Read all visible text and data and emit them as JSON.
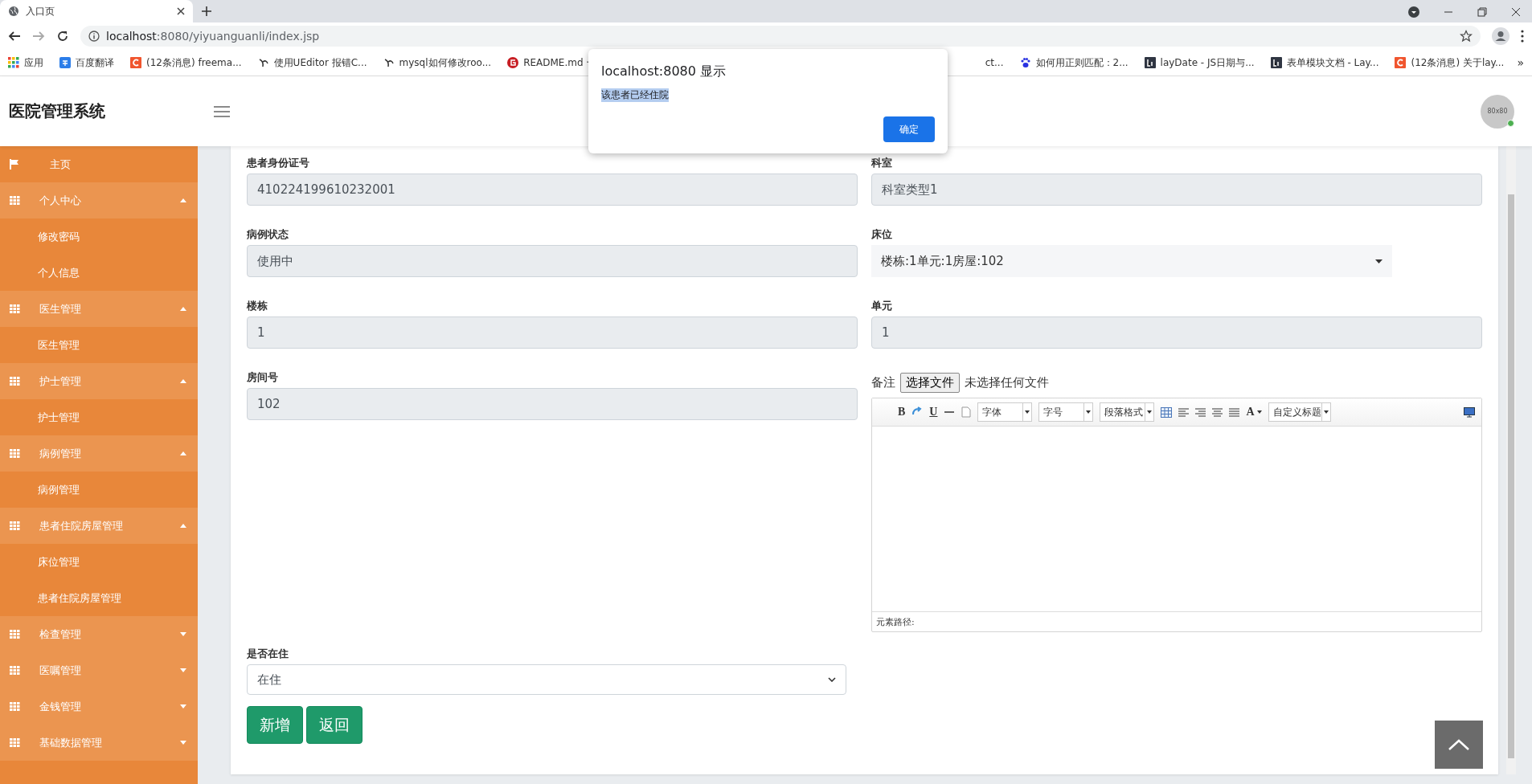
{
  "browser": {
    "tab_title": "入口页",
    "url_host": "localhost",
    "url_rest": ":8080/yiyuanguanli/index.jsp",
    "bookmarks_left": [
      {
        "label": "应用",
        "kind": "apps"
      },
      {
        "label": "百度翻译",
        "kind": "blue-square"
      },
      {
        "label": "(12条消息) freema...",
        "kind": "csdn"
      },
      {
        "label": "使用UEditor 报错C...",
        "kind": "fork"
      },
      {
        "label": "mysql如何修改roo...",
        "kind": "fork"
      },
      {
        "label": "README.md ·",
        "kind": "gitee"
      }
    ],
    "bookmarks_right": [
      {
        "label": "ct...",
        "kind": "none"
      },
      {
        "label": "如何用正则匹配：2...",
        "kind": "paw"
      },
      {
        "label": "layDate - JS日期与...",
        "kind": "layui"
      },
      {
        "label": "表单模块文档 - Lay...",
        "kind": "layui"
      },
      {
        "label": "(12条消息) 关于lay...",
        "kind": "csdn"
      }
    ],
    "bookmarks_more": "»"
  },
  "dialog": {
    "title": "localhost:8080 显示",
    "message": "该患者已经住院",
    "message_highlighted": true,
    "button": "确定"
  },
  "header": {
    "title": "医院管理系统",
    "avatar_text": "80x80",
    "online": true
  },
  "sidebar": {
    "items": [
      {
        "label": "主页",
        "kind": "link"
      },
      {
        "label": "个人中心",
        "kind": "group",
        "expanded": true,
        "children": [
          {
            "label": "修改密码"
          },
          {
            "label": "个人信息"
          }
        ]
      },
      {
        "label": "医生管理",
        "kind": "group",
        "expanded": true,
        "children": [
          {
            "label": "医生管理"
          }
        ]
      },
      {
        "label": "护士管理",
        "kind": "group",
        "expanded": true,
        "children": [
          {
            "label": "护士管理"
          }
        ]
      },
      {
        "label": "病例管理",
        "kind": "group",
        "expanded": true,
        "children": [
          {
            "label": "病例管理"
          }
        ]
      },
      {
        "label": "患者住院房屋管理",
        "kind": "group",
        "expanded": true,
        "children": [
          {
            "label": "床位管理"
          },
          {
            "label": "患者住院房屋管理"
          }
        ]
      },
      {
        "label": "检查管理",
        "kind": "group",
        "expanded": false
      },
      {
        "label": "医嘱管理",
        "kind": "group",
        "expanded": false
      },
      {
        "label": "金钱管理",
        "kind": "group",
        "expanded": false
      },
      {
        "label": "基础数据管理",
        "kind": "group",
        "expanded": false
      }
    ]
  },
  "form": {
    "left_column": [
      {
        "label": "患者身份证号",
        "kind": "input",
        "value": "410224199610232001",
        "disabled": true
      },
      {
        "label": "病例状态",
        "kind": "input",
        "value": "使用中",
        "disabled": true
      },
      {
        "label": "楼栋",
        "kind": "input",
        "value": "1",
        "disabled": true
      },
      {
        "label": "房间号",
        "kind": "input",
        "value": "102",
        "disabled": true
      }
    ],
    "right_column": [
      {
        "label": "科室",
        "kind": "input",
        "value": "科室类型1",
        "disabled": true
      },
      {
        "label": "床位",
        "kind": "plain-select",
        "value": "楼栋:1单元:1房屋:102"
      },
      {
        "label": "单元",
        "kind": "input",
        "value": "1",
        "disabled": true
      },
      {
        "label": "备注",
        "kind": "editor",
        "file_button": "选择文件",
        "file_status": "未选择任何文件",
        "toolbar": [
          {
            "kind": "glyph",
            "text": "B"
          },
          {
            "kind": "link"
          },
          {
            "kind": "glyph",
            "text": "U"
          },
          {
            "kind": "rule"
          },
          {
            "kind": "page"
          },
          {
            "kind": "select",
            "text": "字体"
          },
          {
            "kind": "select",
            "text": "字号"
          },
          {
            "kind": "select",
            "text": "段落格式"
          },
          {
            "kind": "table"
          },
          {
            "kind": "align-left"
          },
          {
            "kind": "align-right"
          },
          {
            "kind": "align-center"
          },
          {
            "kind": "justify"
          },
          {
            "kind": "glyph-menu",
            "text": "A"
          },
          {
            "kind": "select",
            "text": "自定义标题"
          }
        ],
        "path_label": "元素路径:"
      }
    ],
    "residence": {
      "label": "是否在住",
      "value": "在住"
    },
    "buttons": [
      "新增",
      "返回"
    ]
  }
}
